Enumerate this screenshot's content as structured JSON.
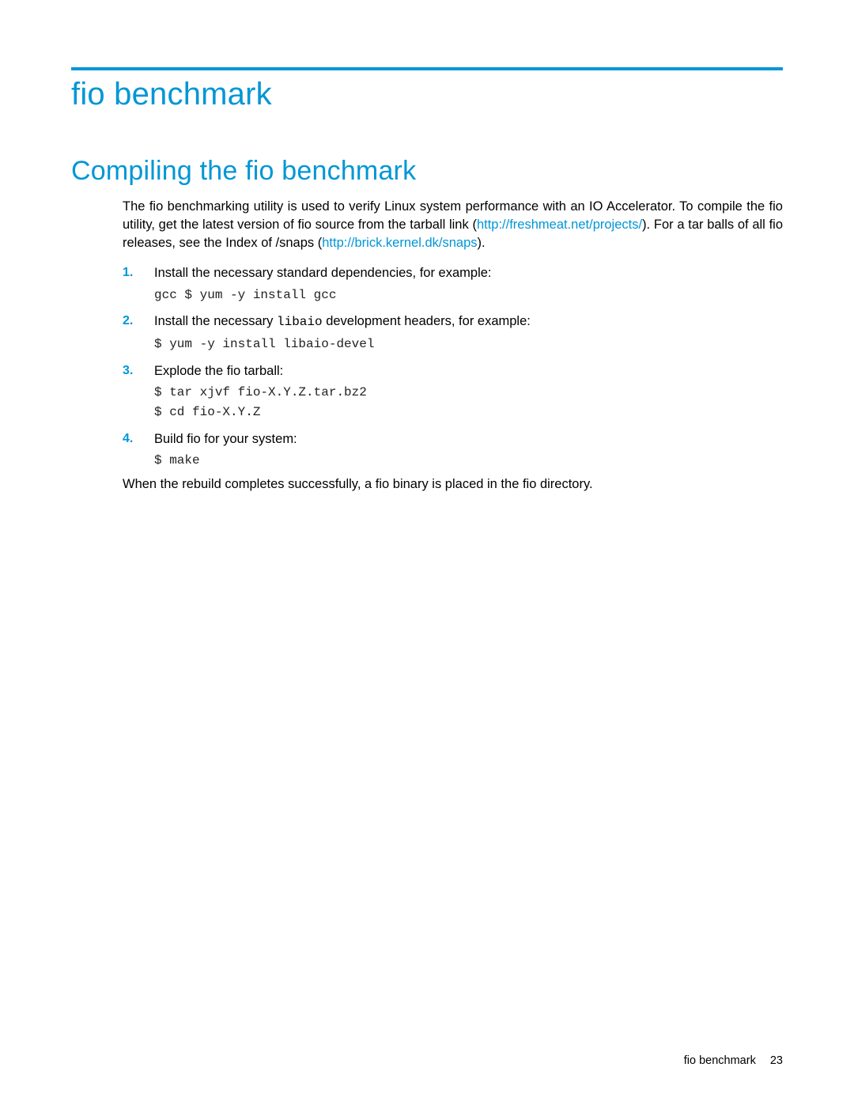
{
  "heading": "fio benchmark",
  "subheading": "Compiling the fio benchmark",
  "intro": {
    "part1": "The fio benchmarking utility is used to verify Linux system performance with an IO Accelerator. To compile the fio utility, get the latest version of fio source from the tarball link (",
    "link1_text": "http://freshmeat.net/projects/",
    "part2": "). For a tar balls of all fio releases, see the Index of /snaps (",
    "link2_text": "http://brick.kernel.dk/snaps",
    "part3": ")."
  },
  "steps": [
    {
      "text": "Install the necessary standard dependencies, for example:",
      "code": "gcc $ yum -y install gcc"
    },
    {
      "text_before": "Install the necessary ",
      "inline_code": "libaio",
      "text_after": " development headers, for example:",
      "code": "$ yum -y install libaio-devel"
    },
    {
      "text": "Explode the fio tarball:",
      "code": "$ tar xjvf fio-X.Y.Z.tar.bz2\n$ cd fio-X.Y.Z"
    },
    {
      "text": "Build fio for your system:",
      "code": "$ make"
    }
  ],
  "closing": "When the rebuild completes successfully, a fio binary is placed in the fio directory.",
  "footer": {
    "label": "fio benchmark",
    "page": "23"
  }
}
